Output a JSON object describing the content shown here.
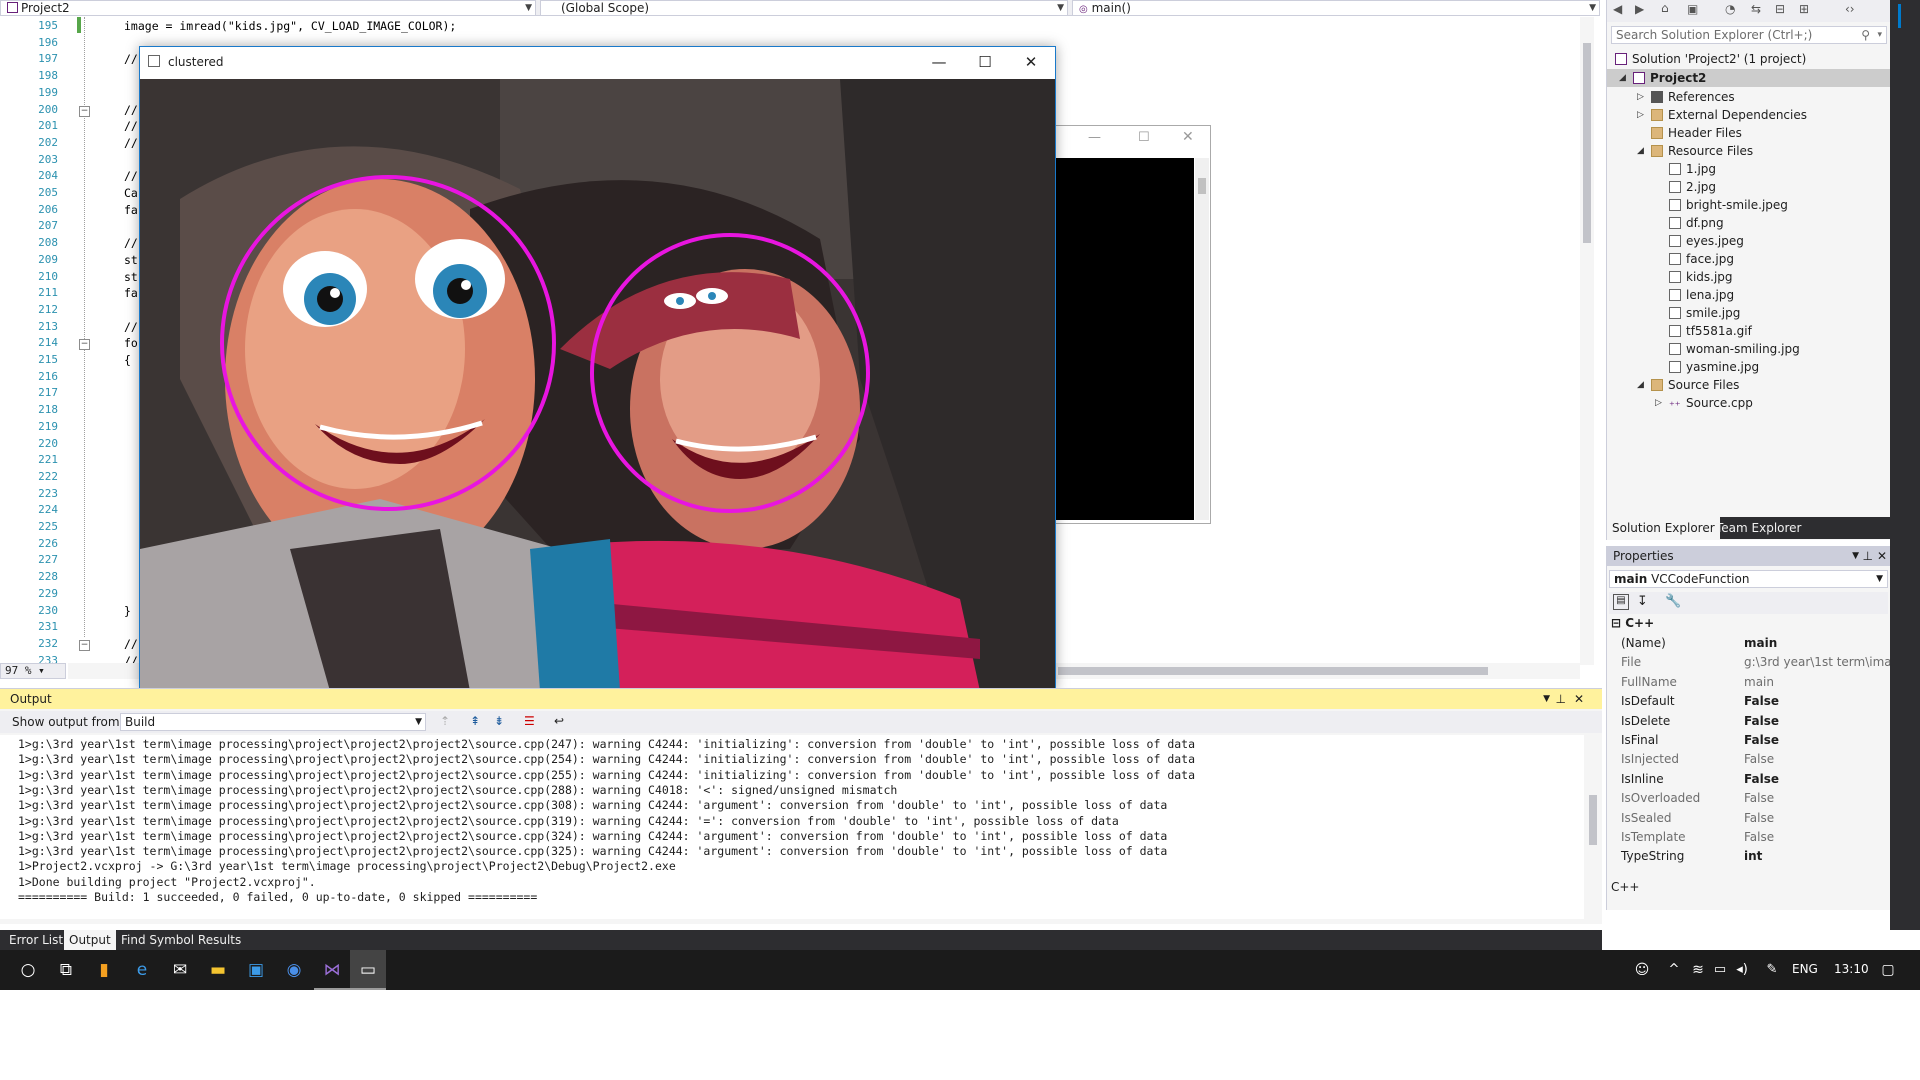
{
  "nav": {
    "project": "Project2",
    "scope": "(Global Scope)",
    "member": "main()"
  },
  "editor": {
    "lines": [
      {
        "n": "195",
        "code": "image = imread(\"kids.jpg\", CV_LOAD_IMAGE_COLOR);"
      },
      {
        "n": "196",
        "code": ""
      },
      {
        "n": "197",
        "code": "//"
      },
      {
        "n": "198",
        "code": ""
      },
      {
        "n": "199",
        "code": ""
      },
      {
        "n": "200",
        "code": "//"
      },
      {
        "n": "201",
        "code": "//"
      },
      {
        "n": "202",
        "code": "//"
      },
      {
        "n": "203",
        "code": ""
      },
      {
        "n": "204",
        "code": "//"
      },
      {
        "n": "205",
        "code": "Ca"
      },
      {
        "n": "206",
        "code": "fa"
      },
      {
        "n": "207",
        "code": ""
      },
      {
        "n": "208",
        "code": "//"
      },
      {
        "n": "209",
        "code": "st"
      },
      {
        "n": "210",
        "code": "st"
      },
      {
        "n": "211",
        "code": "fa"
      },
      {
        "n": "212",
        "code": ""
      },
      {
        "n": "213",
        "code": "//"
      },
      {
        "n": "214",
        "code": "fo"
      },
      {
        "n": "215",
        "code": "{"
      },
      {
        "n": "216",
        "code": ""
      },
      {
        "n": "217",
        "code": ""
      },
      {
        "n": "218",
        "code": ""
      },
      {
        "n": "219",
        "code": ""
      },
      {
        "n": "220",
        "code": ""
      },
      {
        "n": "221",
        "code": ""
      },
      {
        "n": "222",
        "code": ""
      },
      {
        "n": "223",
        "code": ""
      },
      {
        "n": "224",
        "code": ""
      },
      {
        "n": "225",
        "code": ""
      },
      {
        "n": "226",
        "code": ""
      },
      {
        "n": "227",
        "code": ""
      },
      {
        "n": "228",
        "code": ""
      },
      {
        "n": "229",
        "code": ""
      },
      {
        "n": "230",
        "code": "}"
      },
      {
        "n": "231",
        "code": ""
      },
      {
        "n": "232",
        "code": "//"
      },
      {
        "n": "233",
        "code": "//"
      }
    ],
    "zoom": "97 %"
  },
  "clustered_window": {
    "title": "clustered"
  },
  "solution_explorer": {
    "search_placeholder": "Search Solution Explorer (Ctrl+;)",
    "solution": "Solution 'Project2' (1 project)",
    "project": "Project2",
    "references": "References",
    "external": "External Dependencies",
    "header_files": "Header Files",
    "resource_files": "Resource Files",
    "resources": [
      "1.jpg",
      "2.jpg",
      "bright-smile.jpeg",
      "df.png",
      "eyes.jpeg",
      "face.jpg",
      "kids.jpg",
      "lena.jpg",
      "smile.jpg",
      "tf5581a.gif",
      "woman-smiling.jpg",
      "yasmine.jpg"
    ],
    "source_files": "Source Files",
    "source_cpp": "Source.cpp",
    "tabs": [
      "Solution Explorer",
      "Team Explorer"
    ]
  },
  "properties": {
    "title": "Properties",
    "object": "main",
    "object_type": "VCCodeFunction",
    "category": "C++",
    "rows": [
      {
        "name": "(Name)",
        "value": "main",
        "dim": false,
        "bold": true
      },
      {
        "name": "File",
        "value": "g:\\3rd year\\1st term\\ima",
        "dim": true,
        "bold": false
      },
      {
        "name": "FullName",
        "value": "main",
        "dim": true,
        "bold": false
      },
      {
        "name": "IsDefault",
        "value": "False",
        "dim": false,
        "bold": true
      },
      {
        "name": "IsDelete",
        "value": "False",
        "dim": false,
        "bold": true
      },
      {
        "name": "IsFinal",
        "value": "False",
        "dim": false,
        "bold": true
      },
      {
        "name": "IsInjected",
        "value": "False",
        "dim": true,
        "bold": false
      },
      {
        "name": "IsInline",
        "value": "False",
        "dim": false,
        "bold": true
      },
      {
        "name": "IsOverloaded",
        "value": "False",
        "dim": true,
        "bold": false
      },
      {
        "name": "IsSealed",
        "value": "False",
        "dim": true,
        "bold": false
      },
      {
        "name": "IsTemplate",
        "value": "False",
        "dim": true,
        "bold": false
      },
      {
        "name": "TypeString",
        "value": "int",
        "dim": false,
        "bold": true
      }
    ],
    "description": "C++"
  },
  "output": {
    "title": "Output",
    "show_from_label": "Show output from:",
    "show_from_value": "Build",
    "lines": [
      "1>g:\\3rd year\\1st term\\image processing\\project\\project2\\project2\\source.cpp(247): warning C4244: 'initializing': conversion from 'double' to 'int', possible loss of data",
      "1>g:\\3rd year\\1st term\\image processing\\project\\project2\\project2\\source.cpp(254): warning C4244: 'initializing': conversion from 'double' to 'int', possible loss of data",
      "1>g:\\3rd year\\1st term\\image processing\\project\\project2\\project2\\source.cpp(255): warning C4244: 'initializing': conversion from 'double' to 'int', possible loss of data",
      "1>g:\\3rd year\\1st term\\image processing\\project\\project2\\project2\\source.cpp(288): warning C4018: '<': signed/unsigned mismatch",
      "1>g:\\3rd year\\1st term\\image processing\\project\\project2\\project2\\source.cpp(308): warning C4244: 'argument': conversion from 'double' to 'int', possible loss of data",
      "1>g:\\3rd year\\1st term\\image processing\\project\\project2\\project2\\source.cpp(319): warning C4244: '=': conversion from 'double' to 'int', possible loss of data",
      "1>g:\\3rd year\\1st term\\image processing\\project\\project2\\project2\\source.cpp(324): warning C4244: 'argument': conversion from 'double' to 'int', possible loss of data",
      "1>g:\\3rd year\\1st term\\image processing\\project\\project2\\project2\\source.cpp(325): warning C4244: 'argument': conversion from 'double' to 'int', possible loss of data",
      "1>Project2.vcxproj -> G:\\3rd year\\1st term\\image processing\\project\\Project2\\Debug\\Project2.exe",
      "1>Done building project \"Project2.vcxproj\".",
      "========== Build: 1 succeeded, 0 failed, 0 up-to-date, 0 skipped =========="
    ],
    "tabs": [
      "Error List",
      "Output",
      "Find Symbol Results"
    ]
  },
  "taskbar": {
    "language": "ENG",
    "time": "13:10"
  },
  "colors": {
    "accent": "#007acc",
    "circle": "#e815e0",
    "output_title": "#fff29d"
  }
}
